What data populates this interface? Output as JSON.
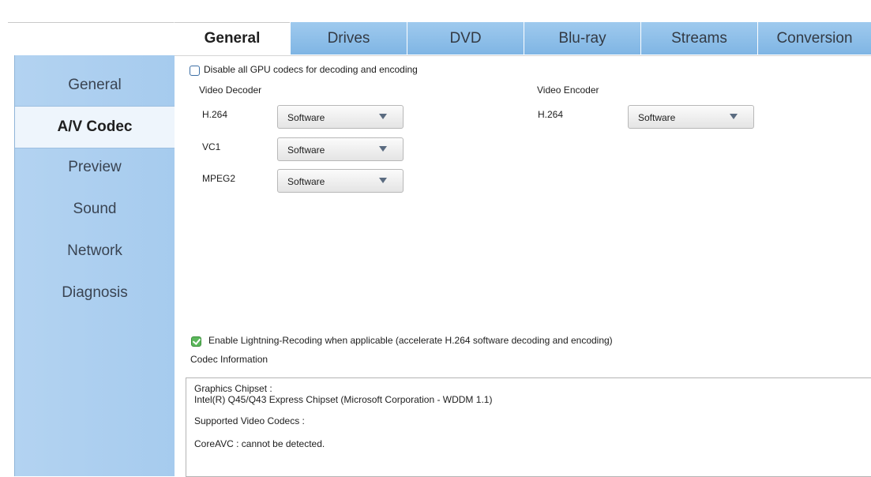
{
  "tabs": [
    {
      "label": "General",
      "active": true
    },
    {
      "label": "Drives",
      "active": false
    },
    {
      "label": "DVD",
      "active": false
    },
    {
      "label": "Blu-ray",
      "active": false
    },
    {
      "label": "Streams",
      "active": false
    },
    {
      "label": "Conversion",
      "active": false
    }
  ],
  "sidebar": {
    "items": [
      {
        "label": "General",
        "active": false
      },
      {
        "label": "A/V Codec",
        "active": true
      },
      {
        "label": "Preview",
        "active": false
      },
      {
        "label": "Sound",
        "active": false
      },
      {
        "label": "Network",
        "active": false
      },
      {
        "label": "Diagnosis",
        "active": false
      }
    ]
  },
  "content": {
    "disable_gpu": {
      "label": "Disable all GPU codecs for decoding and encoding",
      "checked": false
    },
    "video_decoder": {
      "title": "Video Decoder",
      "rows": [
        {
          "label": "H.264",
          "value": "Software"
        },
        {
          "label": "VC1",
          "value": "Software"
        },
        {
          "label": "MPEG2",
          "value": "Software"
        }
      ]
    },
    "video_encoder": {
      "title": "Video Encoder",
      "rows": [
        {
          "label": "H.264",
          "value": "Software"
        }
      ]
    },
    "lightning": {
      "label": "Enable Lightning-Recoding when applicable (accelerate H.264 software decoding and encoding)",
      "checked": true
    },
    "codec_info": {
      "title": "Codec Information",
      "graphics_label": "Graphics Chipset :",
      "graphics_value": "Intel(R) Q45/Q43 Express Chipset (Microsoft Corporation - WDDM 1.1)",
      "supported_label": "Supported Video Codecs :",
      "coreavc": "CoreAVC : cannot be detected."
    }
  },
  "colors": {
    "tab_bg": "#8fbfe9",
    "sidebar_bg": "#acd0f0",
    "checkbox_checked": "#5cb85c"
  }
}
